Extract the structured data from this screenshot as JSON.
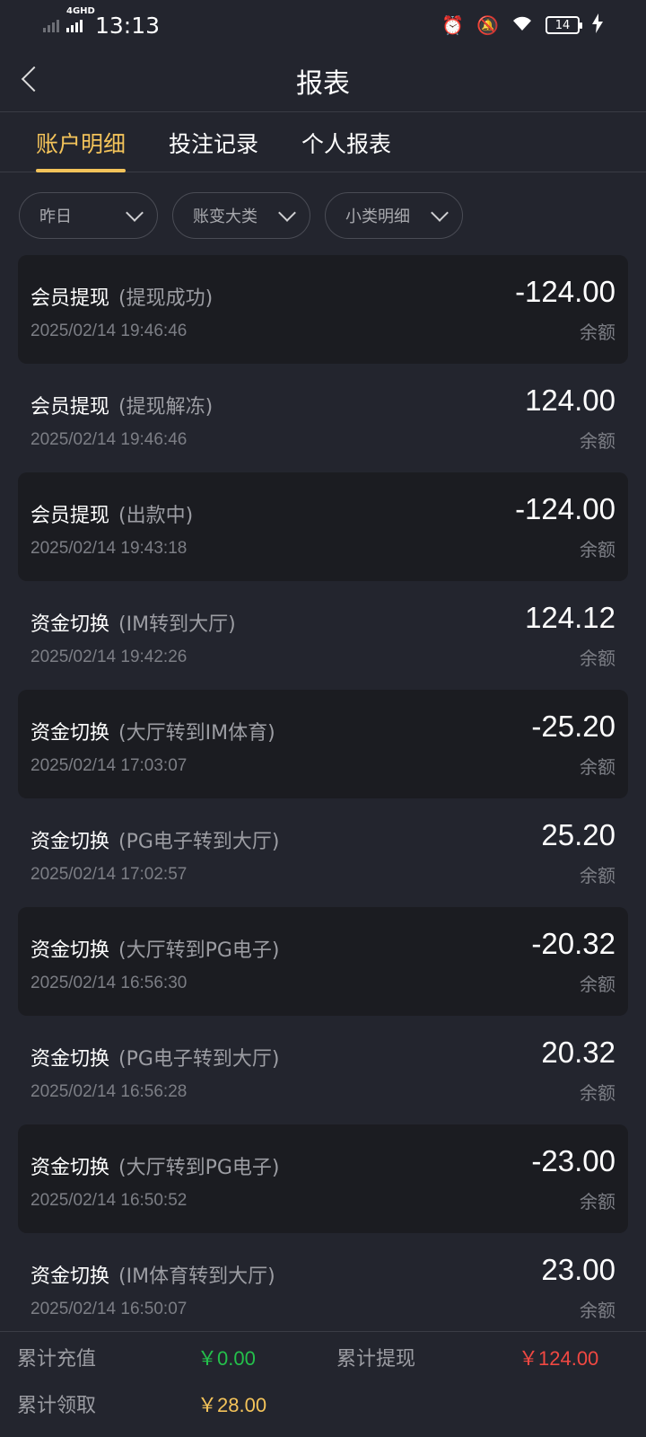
{
  "status_bar": {
    "network": "4GHD",
    "time": "13:13",
    "battery": "14"
  },
  "header": {
    "title": "报表"
  },
  "tabs": [
    {
      "label": "账户明细",
      "active": true
    },
    {
      "label": "投注记录",
      "active": false
    },
    {
      "label": "个人报表",
      "active": false
    }
  ],
  "filters": [
    {
      "label": "昨日"
    },
    {
      "label": "账变大类"
    },
    {
      "label": "小类明细"
    }
  ],
  "records": [
    {
      "title": "会员提现",
      "subtitle": "(提现成功)",
      "time": "2025/02/14 19:46:46",
      "amount": "-124.00",
      "balance_label": "余额"
    },
    {
      "title": "会员提现",
      "subtitle": "(提现解冻)",
      "time": "2025/02/14 19:46:46",
      "amount": "124.00",
      "balance_label": "余额"
    },
    {
      "title": "会员提现",
      "subtitle": "(出款中)",
      "time": "2025/02/14 19:43:18",
      "amount": "-124.00",
      "balance_label": "余额"
    },
    {
      "title": "资金切换",
      "subtitle": "(IM转到大厅)",
      "time": "2025/02/14 19:42:26",
      "amount": "124.12",
      "balance_label": "余额"
    },
    {
      "title": "资金切换",
      "subtitle": "(大厅转到IM体育)",
      "time": "2025/02/14 17:03:07",
      "amount": "-25.20",
      "balance_label": "余额"
    },
    {
      "title": "资金切换",
      "subtitle": "(PG电子转到大厅)",
      "time": "2025/02/14 17:02:57",
      "amount": "25.20",
      "balance_label": "余额"
    },
    {
      "title": "资金切换",
      "subtitle": "(大厅转到PG电子)",
      "time": "2025/02/14 16:56:30",
      "amount": "-20.32",
      "balance_label": "余额"
    },
    {
      "title": "资金切换",
      "subtitle": "(PG电子转到大厅)",
      "time": "2025/02/14 16:56:28",
      "amount": "20.32",
      "balance_label": "余额"
    },
    {
      "title": "资金切换",
      "subtitle": "(大厅转到PG电子)",
      "time": "2025/02/14 16:50:52",
      "amount": "-23.00",
      "balance_label": "余额"
    },
    {
      "title": "资金切换",
      "subtitle": "(IM体育转到大厅)",
      "time": "2025/02/14 16:50:07",
      "amount": "23.00",
      "balance_label": "余额"
    }
  ],
  "footer": {
    "total_deposit_label": "累计充值",
    "total_deposit_value": "￥0.00",
    "total_withdraw_label": "累计提现",
    "total_withdraw_value": "￥124.00",
    "total_claim_label": "累计领取",
    "total_claim_value": "￥28.00"
  },
  "colors": {
    "accent": "#f3c35a",
    "deposit": "#24c04b",
    "withdraw": "#f04842",
    "background": "#23252e",
    "row_shade": "#1b1c21"
  }
}
